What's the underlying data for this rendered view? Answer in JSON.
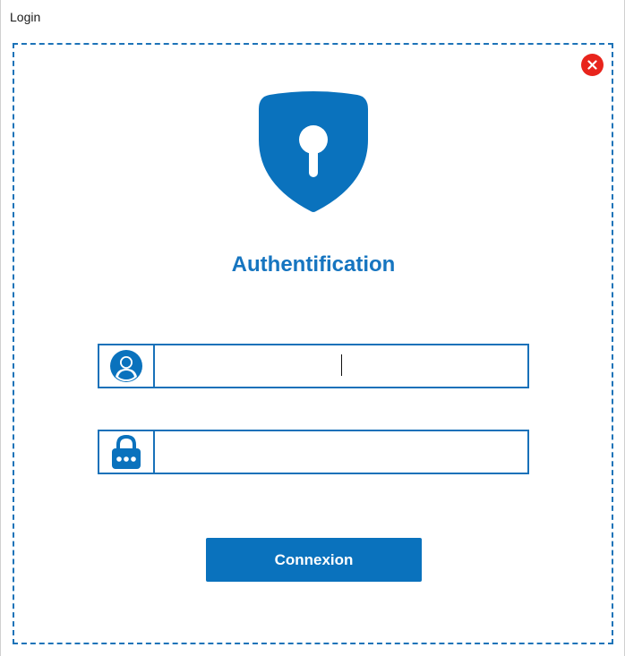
{
  "window": {
    "title": "Login"
  },
  "close_button": {
    "icon": "close-icon",
    "color": "#e8241c"
  },
  "logo": {
    "icon": "shield-keyhole-icon",
    "color": "#0a72bd"
  },
  "heading": "Authentification",
  "username_field": {
    "icon": "user-icon",
    "value": "",
    "placeholder": ""
  },
  "password_field": {
    "icon": "padlock-icon",
    "value": "",
    "placeholder": ""
  },
  "submit_button": {
    "label": "Connexion"
  },
  "colors": {
    "accent": "#1675c0",
    "frame": "#1d73b8",
    "close": "#e8241c"
  }
}
